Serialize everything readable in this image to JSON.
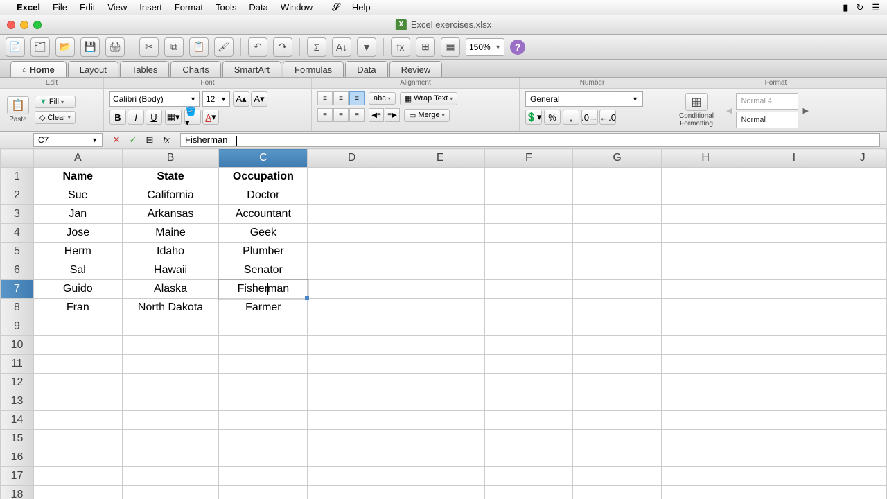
{
  "mac_menu": {
    "app": "Excel",
    "items": [
      "File",
      "Edit",
      "View",
      "Insert",
      "Format",
      "Tools",
      "Data",
      "Window",
      "Help"
    ]
  },
  "window": {
    "title": "Excel exercises.xlsx"
  },
  "toolbar": {
    "zoom": "150%"
  },
  "ribbon": {
    "tabs": [
      "Home",
      "Layout",
      "Tables",
      "Charts",
      "SmartArt",
      "Formulas",
      "Data",
      "Review"
    ],
    "active_tab": "Home",
    "groups": {
      "edit": {
        "label": "Edit",
        "paste": "Paste",
        "fill": "Fill",
        "clear": "Clear"
      },
      "font": {
        "label": "Font",
        "name": "Calibri (Body)",
        "size": "12"
      },
      "alignment": {
        "label": "Alignment",
        "wrap": "Wrap Text",
        "merge": "Merge",
        "orient": "abc"
      },
      "number": {
        "label": "Number",
        "format": "General"
      },
      "format": {
        "label": "Format",
        "cond": "Conditional Formatting",
        "style1": "Normal 4",
        "style2": "Normal"
      }
    }
  },
  "formula_bar": {
    "cell_ref": "C7",
    "value": "Fisherman",
    "cursor_after": "Fisherma"
  },
  "columns": [
    "A",
    "B",
    "C",
    "D",
    "E",
    "F",
    "G",
    "H",
    "I",
    "J"
  ],
  "selected_col": "C",
  "selected_row": 7,
  "editing": {
    "row": 7,
    "col": "C",
    "pre": "Fisher",
    "post": "man"
  },
  "chart_data": {
    "type": "table",
    "headers": {
      "A": "Name",
      "B": "State",
      "C": "Occupation"
    },
    "rows": [
      {
        "row": 2,
        "A": "Sue",
        "B": "California",
        "C": "Doctor"
      },
      {
        "row": 3,
        "A": "Jan",
        "B": "Arkansas",
        "C": "Accountant"
      },
      {
        "row": 4,
        "A": "Jose",
        "B": "Maine",
        "C": "Geek"
      },
      {
        "row": 5,
        "A": "Herm",
        "B": "Idaho",
        "C": "Plumber"
      },
      {
        "row": 6,
        "A": "Sal",
        "B": "Hawaii",
        "C": "Senator"
      },
      {
        "row": 7,
        "A": "Guido",
        "B": "Alaska",
        "C": "Fisherman"
      },
      {
        "row": 8,
        "A": "Fran",
        "B": "North Dakota",
        "C": "Farmer"
      }
    ]
  },
  "visible_rows": 18
}
